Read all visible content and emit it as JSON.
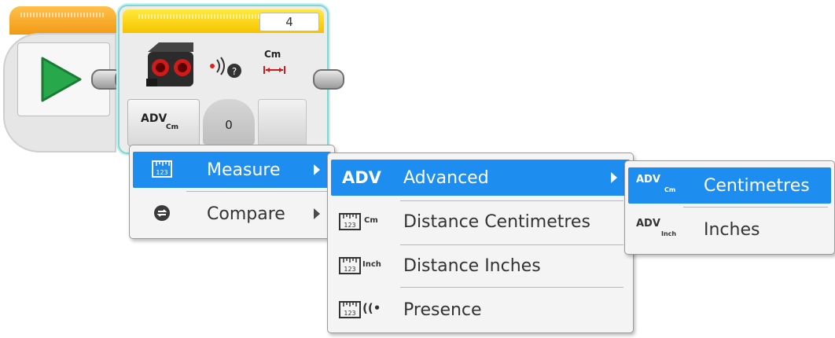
{
  "start_block": {
    "icon": "play-icon"
  },
  "sensor_block": {
    "port": "4",
    "unit_label": "Cm",
    "mode_label": "ADV",
    "mode_sub": "Cm",
    "input_value": "0"
  },
  "menu_main": {
    "items": [
      {
        "label": "Measure",
        "icon": "ruler-icon",
        "selected": true
      },
      {
        "label": "Compare",
        "icon": "compare-icon",
        "selected": false
      }
    ]
  },
  "menu_measure": {
    "items": [
      {
        "label": "Advanced",
        "icon_text": "ADV",
        "selected": true
      },
      {
        "label": "Distance Centimetres",
        "icon_text": "Cm",
        "selected": false
      },
      {
        "label": "Distance Inches",
        "icon_text": "Inch",
        "selected": false
      },
      {
        "label": "Presence",
        "icon_text": "((•",
        "selected": false
      }
    ]
  },
  "menu_advanced": {
    "items": [
      {
        "label": "Centimetres",
        "icon_main": "ADV",
        "icon_sub": "Cm",
        "selected": true
      },
      {
        "label": "Inches",
        "icon_main": "ADV",
        "icon_sub": "Inch",
        "selected": false
      }
    ]
  },
  "colors": {
    "accent": "#1d8df0",
    "start": "#f19a14",
    "sensor": "#f5c400",
    "play": "#27a84a"
  }
}
